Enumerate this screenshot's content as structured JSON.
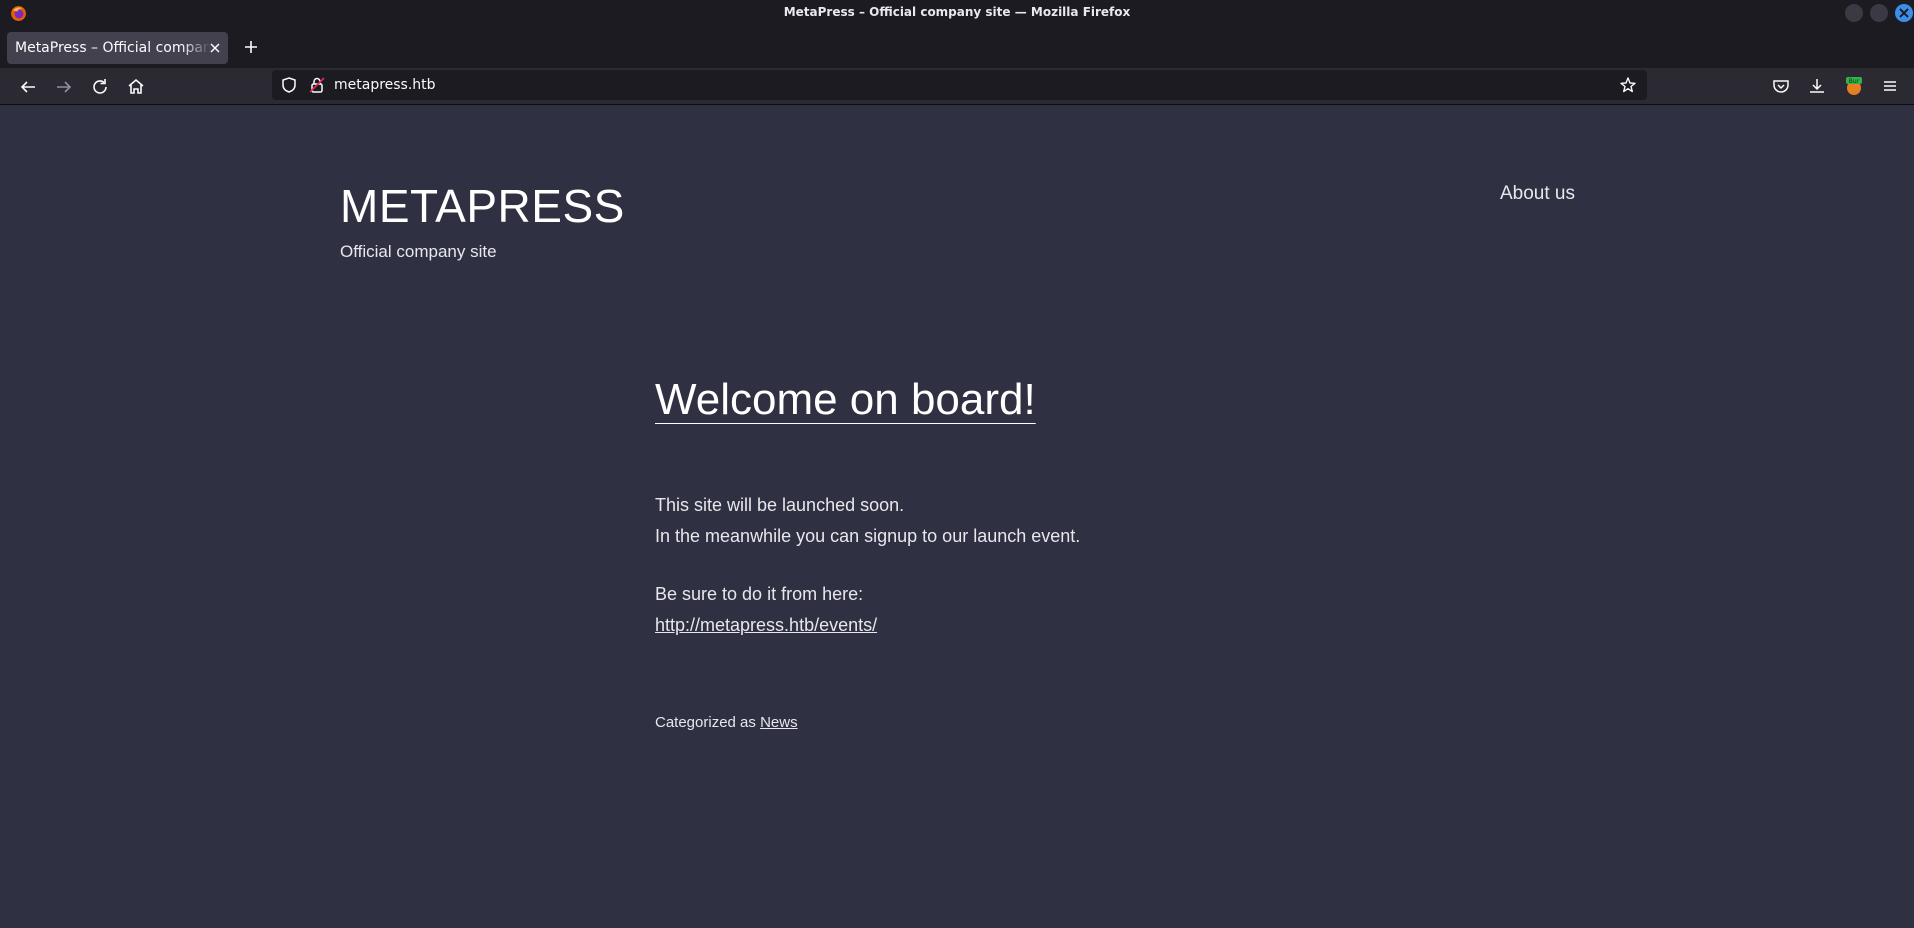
{
  "window": {
    "title": "MetaPress – Official company site — Mozilla Firefox"
  },
  "tabs": [
    {
      "label": "MetaPress – Official company site",
      "active": true
    }
  ],
  "navbar": {
    "url": "metapress.htb"
  },
  "site": {
    "title": "METAPRESS",
    "description": "Official company site",
    "menu": [
      {
        "label": "About us"
      }
    ]
  },
  "post": {
    "title": "Welcome on board!",
    "line1": "This site will be launched soon.",
    "line2": "In the meanwhile you can signup to our launch event.",
    "line3": "Be sure to do it from here:",
    "link": "http://metapress.htb/events/",
    "category_prefix": "Categorized as",
    "category": "News"
  },
  "colors": {
    "page_bg": "#2f3042",
    "chrome_bg": "#1c1b22",
    "navbar_bg": "#2b2a33",
    "text": "#e7e7ec",
    "close_button": "#3b8fe8"
  },
  "icons": {
    "toolbar": [
      "back-icon",
      "forward-icon",
      "reload-icon",
      "home-icon",
      "pocket-icon",
      "downloads-icon",
      "burp-extension-icon",
      "menu-icon"
    ],
    "urlbar": [
      "shield-icon",
      "lock-icon",
      "bookmark-star-icon"
    ]
  }
}
